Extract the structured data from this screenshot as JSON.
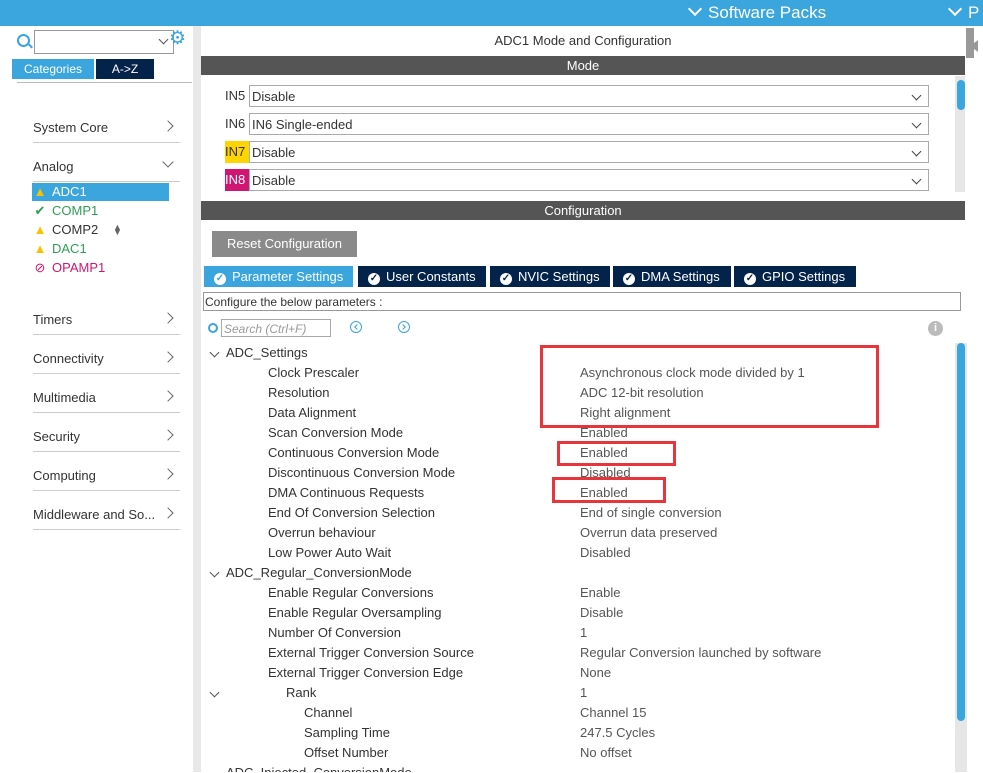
{
  "topbar": {
    "software_packs": "Software Packs",
    "pinout": "P"
  },
  "left": {
    "category_tab": "Categories",
    "az_tab": "A->Z",
    "categories_top": [
      {
        "label": "System Core",
        "expanded": false
      },
      {
        "label": "Analog",
        "expanded": true
      }
    ],
    "peripherals": [
      {
        "label": "ADC1",
        "status": "warning",
        "selected": true
      },
      {
        "label": "COMP1",
        "status": "ok",
        "selected": false
      },
      {
        "label": "COMP2",
        "status": "warning",
        "selected": false
      },
      {
        "label": "DAC1",
        "status": "warning",
        "selected": false
      },
      {
        "label": "OPAMP1",
        "status": "disabled",
        "selected": false
      }
    ],
    "categories_bottom": [
      {
        "label": "Timers"
      },
      {
        "label": "Connectivity"
      },
      {
        "label": "Multimedia"
      },
      {
        "label": "Security"
      },
      {
        "label": "Computing"
      },
      {
        "label": "Middleware and So..."
      }
    ]
  },
  "title": "ADC1 Mode and Configuration",
  "mode_header": "Mode",
  "mode_rows": [
    {
      "label": "IN5",
      "value": "Disable",
      "highlight": ""
    },
    {
      "label": "IN6",
      "value": "IN6 Single-ended",
      "highlight": ""
    },
    {
      "label": "IN7",
      "value": "Disable",
      "highlight": "yellow"
    },
    {
      "label": "IN8",
      "value": "Disable",
      "highlight": "magenta"
    }
  ],
  "config_header": "Configuration",
  "reset_label": "Reset Configuration",
  "param_tabs": [
    "Parameter Settings",
    "User Constants",
    "NVIC Settings",
    "DMA Settings",
    "GPIO Settings"
  ],
  "configure_text": "Configure the below parameters :",
  "search_placeholder": "Search (Ctrl+F)",
  "info_symbol": "i",
  "tree": [
    {
      "key": "ADC_Settings",
      "value": "",
      "level": 0
    },
    {
      "key": "Clock Prescaler",
      "value": "Asynchronous clock mode divided by 1",
      "level": 1
    },
    {
      "key": "Resolution",
      "value": "ADC 12-bit resolution",
      "level": 1
    },
    {
      "key": "Data Alignment",
      "value": "Right alignment",
      "level": 1
    },
    {
      "key": "Scan Conversion Mode",
      "value": "Enabled",
      "level": 1
    },
    {
      "key": "Continuous Conversion Mode",
      "value": "Enabled",
      "level": 1
    },
    {
      "key": "Discontinuous Conversion Mode",
      "value": "Disabled",
      "level": 1
    },
    {
      "key": "DMA Continuous Requests",
      "value": "Enabled",
      "level": 1
    },
    {
      "key": "End Of Conversion Selection",
      "value": "End of single conversion",
      "level": 1
    },
    {
      "key": "Overrun behaviour",
      "value": "Overrun data preserved",
      "level": 1
    },
    {
      "key": "Low Power Auto Wait",
      "value": "Disabled",
      "level": 1
    },
    {
      "key": "ADC_Regular_ConversionMode",
      "value": "",
      "level": 0
    },
    {
      "key": "Enable Regular Conversions",
      "value": "Enable",
      "level": 1
    },
    {
      "key": "Enable Regular Oversampling",
      "value": "Disable",
      "level": 1
    },
    {
      "key": "Number Of Conversion",
      "value": "1",
      "level": 1
    },
    {
      "key": "External Trigger Conversion Source",
      "value": "Regular Conversion launched by software",
      "level": 1
    },
    {
      "key": "External Trigger Conversion Edge",
      "value": "None",
      "level": 1
    },
    {
      "key": "Rank",
      "value": "1",
      "level": 2
    },
    {
      "key": "Channel",
      "value": "Channel 15",
      "level": 3
    },
    {
      "key": "Sampling Time",
      "value": "247.5 Cycles",
      "level": 3
    },
    {
      "key": "Offset Number",
      "value": "No offset",
      "level": 3
    },
    {
      "key": "ADC_Injected_ConversionMode",
      "value": "",
      "level": 0
    }
  ],
  "colors": {
    "accent": "#3aa6dd",
    "tab_dark": "#03234b",
    "annotation_red": "#e8343b"
  }
}
